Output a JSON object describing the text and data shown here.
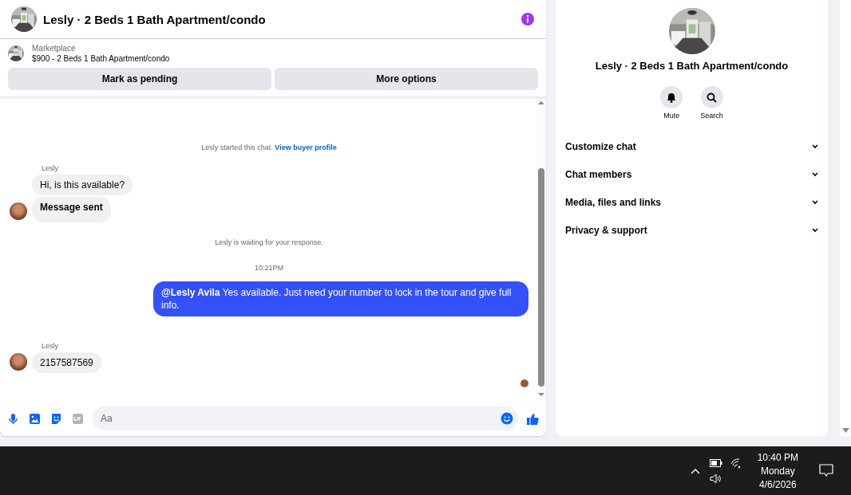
{
  "conversation": {
    "title": "Lesly · 2 Beds 1 Bath Apartment/condo"
  },
  "listing": {
    "source": "Marketplace",
    "summary": "$900 - 2 Beds 1 Bath Apartment/condo",
    "actions": [
      "Mark as pending",
      "More options"
    ]
  },
  "thread": {
    "items": [
      {
        "kind": "notice",
        "text": "Lesly started this chat.",
        "link": "View buyer profile"
      },
      {
        "kind": "incoming",
        "sender": "Lesly",
        "messages": [
          {
            "text": "Hi, is this available?",
            "bold": false
          },
          {
            "text": "Message sent",
            "bold": true
          }
        ]
      },
      {
        "kind": "notice",
        "text": "Lesly is waiting for your response."
      },
      {
        "kind": "time",
        "text": "10:21PM"
      },
      {
        "kind": "outgoing",
        "text": "**@Lesly Avila** Yes available. Just need your number to lock in the tour and give full info."
      },
      {
        "kind": "incoming",
        "sender": "Lesly",
        "messages": [
          {
            "text": "2157587569",
            "bold": false
          }
        ]
      }
    ]
  },
  "composer": {
    "placeholder": "Aa"
  },
  "details": {
    "title": "Lesly · 2 Beds 1 Bath Apartment/condo",
    "actions": [
      {
        "kind": "mute",
        "label": "Mute"
      },
      {
        "kind": "search",
        "label": "Search"
      }
    ],
    "sections": [
      "Customize chat",
      "Chat members",
      "Media, files and links",
      "Privacy & support"
    ]
  },
  "taskbar": {
    "time": "10:40 PM",
    "day": "Monday",
    "date": "4/6/2026"
  }
}
